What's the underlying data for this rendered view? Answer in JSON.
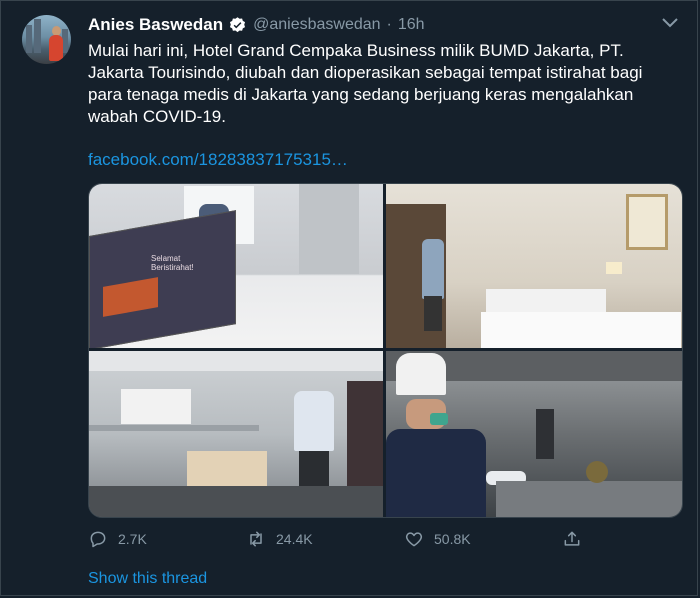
{
  "user": {
    "name": "Anies Baswedan",
    "handle": "@aniesbaswedan",
    "separator": "·",
    "time": "16h"
  },
  "tweet": {
    "text_lines": [
      "Mulai hari ini, Hotel Grand Cempaka Business milik BUMD Jakarta, PT.",
      "Jakarta Tourisindo, diubah dan dioperasikan sebagai tempat istirahat bagi",
      "para tenaga medis di Jakarta yang sedang berjuang keras mengalahkan",
      "wabah COVID-19."
    ],
    "link": "facebook.com/18283837175315…"
  },
  "media": {
    "card_title": "Selamat\nBeristirahat!",
    "icons": [
      "photo-hotel-room-card",
      "photo-hotel-corridor",
      "photo-kitchen-staff",
      "photo-chef"
    ]
  },
  "actions": {
    "reply_count": "2.7K",
    "retweet_count": "24.4K",
    "like_count": "50.8K"
  },
  "thread": {
    "label": "Show this thread"
  },
  "colors": {
    "background": "#15202b",
    "accent": "#1b95e0",
    "secondary_text": "#8899a6",
    "border": "#38444d"
  }
}
